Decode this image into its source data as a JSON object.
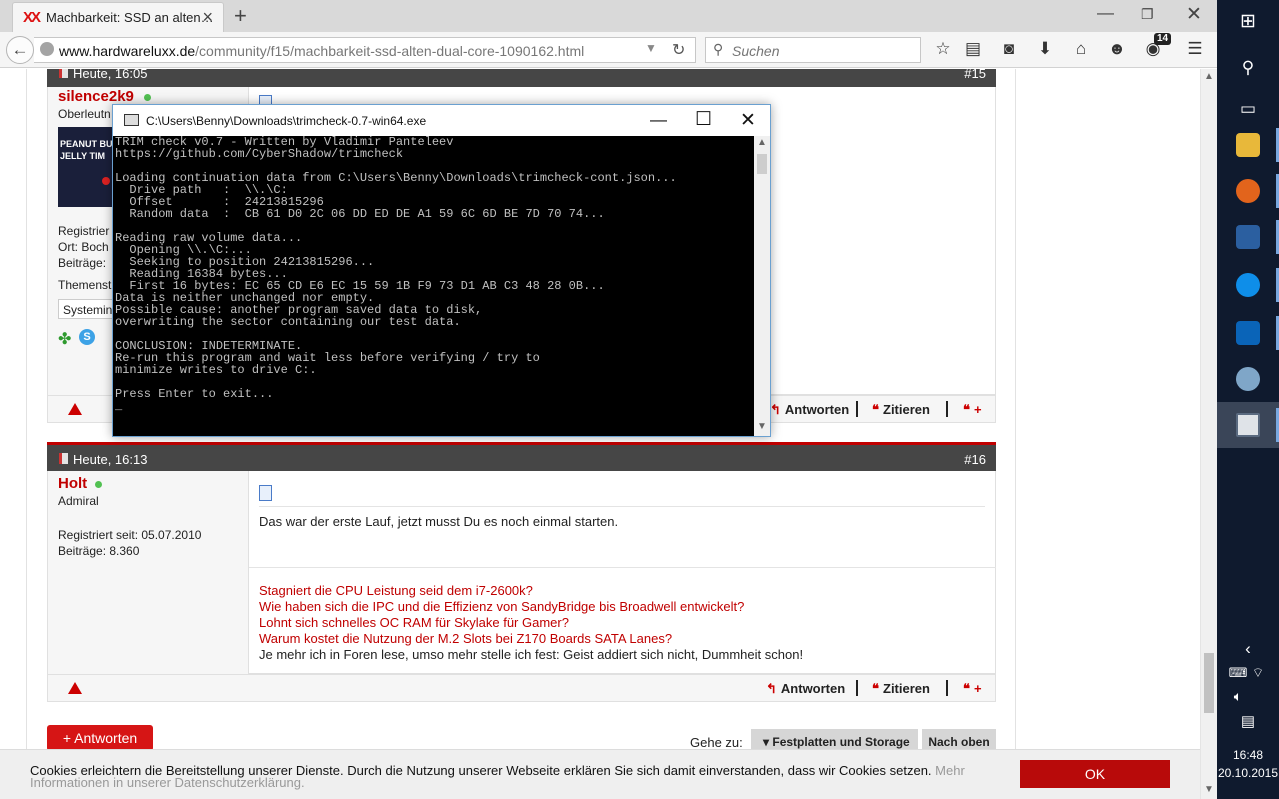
{
  "browser": {
    "tab_title": "Machbarkeit: SSD an alten…",
    "tab_favicon": "XX",
    "new_tab_glyph": "+",
    "url_domain": "www.hardwareluxx.de",
    "url_path": "/community/f15/machbarkeit-ssd-alten-dual-core-1090162.html",
    "search_placeholder": "Suchen",
    "notification_count": "14"
  },
  "posts": {
    "p15": {
      "date": "Heute, 16:05",
      "number": "#15",
      "user": "silence2k9",
      "rank": "Oberleutn",
      "avatar_line1": "PEANUT BUT",
      "avatar_line2": "JELLY TIM",
      "registered": "Registrier",
      "location": "Ort: Boch",
      "posts_count": "Beiträge:",
      "theme": "Themenst",
      "system": "Systemin"
    },
    "p16": {
      "date": "Heute, 16:13",
      "number": "#16",
      "user": "Holt",
      "rank": "Admiral",
      "registered": "Registriert seit: 05.07.2010",
      "posts_count": "Beiträge: 8.360",
      "message": "Das war der erste Lauf, jetzt musst Du es noch einmal starten.",
      "signature_links": [
        "Stagniert die CPU Leistung seid dem i7-2600k?",
        "Wie haben sich die IPC und die Effizienz von SandyBridge bis Broadwell entwickelt?",
        "Lohnt sich schnelles OC RAM für Skylake für Gamer?",
        "Warum kostet die Nutzung der M.2 Slots bei Z170 Boards SATA Lanes?"
      ],
      "signature_quote": "Je mehr ich in Foren lese, umso mehr stelle ich fest: Geist addiert sich nicht, Dummheit schon!"
    }
  },
  "actions": {
    "reply": "Antworten",
    "quote": "Zitieren",
    "multiquote": "+"
  },
  "footer": {
    "reply_button": "+ Antworten",
    "goto_label": "Gehe zu:",
    "goto_value": "▾ Festplatten und Storage",
    "goto_next": "Nach oben"
  },
  "cookie": {
    "text": "Cookies erleichtern die Bereitstellung unserer Dienste. Durch die Nutzung unserer Webseite erklären Sie sich damit einverstanden, dass wir Cookies setzen.",
    "more": "Mehr Informationen in unserer Datenschutzerklärung.",
    "ok": "OK"
  },
  "console": {
    "title": "C:\\Users\\Benny\\Downloads\\trimcheck-0.7-win64.exe",
    "output": "TRIM check v0.7 - Written by Vladimir Panteleev\nhttps://github.com/CyberShadow/trimcheck\n\nLoading continuation data from C:\\Users\\Benny\\Downloads\\trimcheck-cont.json...\n  Drive path   :  \\\\.\\C:\n  Offset       :  24213815296\n  Random data  :  CB 61 D0 2C 06 DD ED DE A1 59 6C 6D BE 7D 70 74...\n\nReading raw volume data...\n  Opening \\\\.\\C:...\n  Seeking to position 24213815296...\n  Reading 16384 bytes...\n  First 16 bytes: EC 65 CD E6 EC 15 59 1B F9 73 D1 AB C3 48 28 0B...\nData is neither unchanged nor empty.\nPossible cause: another program saved data to disk,\noverwriting the sector containing our test data.\n\nCONCLUSION: INDETERMINATE.\nRe-run this program and wait less before verifying / try to\nminimize writes to drive C:.\n\nPress Enter to exit...\n_"
  },
  "taskbar": {
    "time": "16:48",
    "date": "20.10.2015"
  },
  "colors": {
    "accent_red": "#c00000",
    "post_header": "#464646",
    "taskbar": "#0f1a2e"
  }
}
